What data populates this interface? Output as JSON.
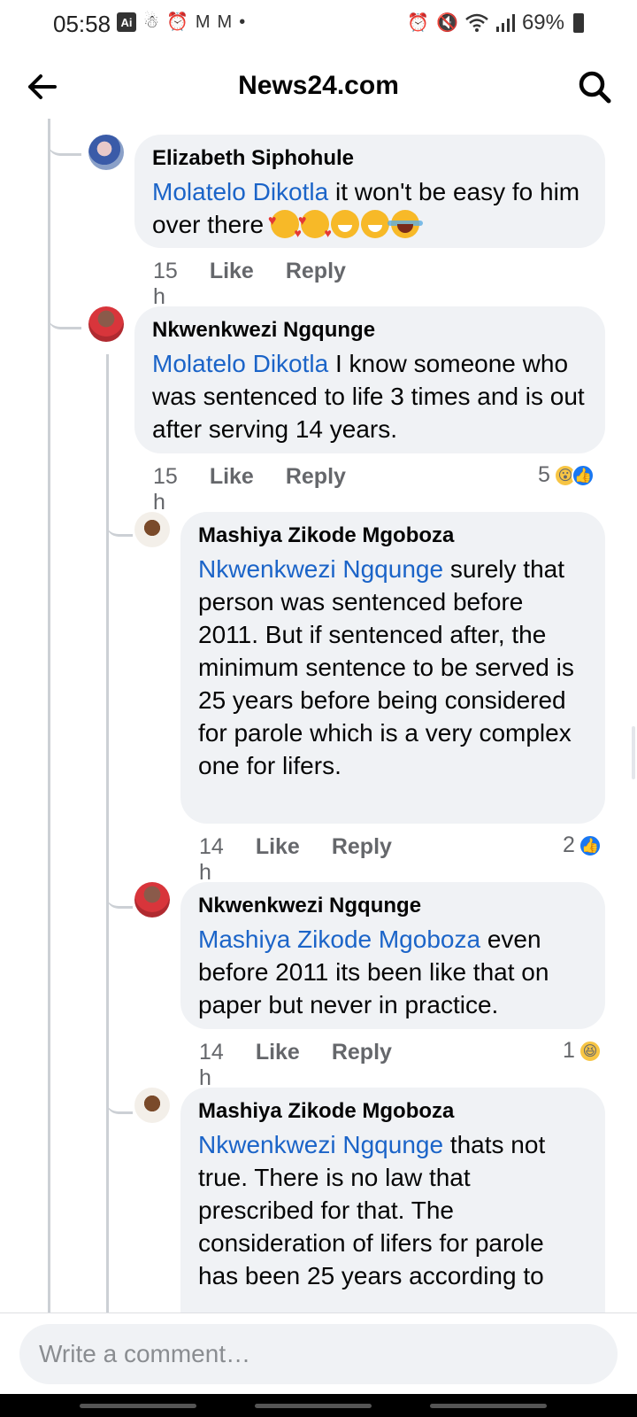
{
  "status_bar": {
    "time": "05:58",
    "ai_badge": "Ai",
    "battery": "69%",
    "left_icons": [
      "figure-icon",
      "alarm-icon",
      "gmail-icon",
      "gmail-icon",
      "dot-icon"
    ],
    "right_icons": [
      "alarm-icon",
      "mute-icon",
      "wifi-icon",
      "signal-icon",
      "battery-icon"
    ]
  },
  "header": {
    "title": "News24.com"
  },
  "comments": [
    {
      "author": "Elizabeth Siphohule",
      "mention": "Molatelo Dikotla",
      "text": " it won't be easy fo him over there ",
      "emojis": [
        "love",
        "love",
        "grin",
        "grin",
        "joy"
      ],
      "time": "15 h",
      "like": "Like",
      "reply": "Reply"
    },
    {
      "author": "Nkwenkwezi Ngqunge",
      "mention": "Molatelo Dikotla",
      "text": " I know someone who was sentenced to life 3 times and is out after serving 14 years.",
      "time": "15 h",
      "like": "Like",
      "reply": "Reply",
      "reaction_count": "5"
    },
    {
      "author": "Mashiya Zikode Mgoboza",
      "mention": "Nkwenkwezi Ngqunge",
      "text": " surely that person was sentenced before 2011. But if sentenced after,  the minimum sentence to be served is 25 years before being considered for parole which is a very complex one for lifers.",
      "time": "14 h",
      "like": "Like",
      "reply": "Reply",
      "reaction_count": "2"
    },
    {
      "author": "Nkwenkwezi Ngqunge",
      "mention": "Mashiya Zikode Mgoboza",
      "text": " even before 2011 its been like that on paper but never in practice.",
      "time": "14 h",
      "like": "Like",
      "reply": "Reply",
      "reaction_count": "1"
    },
    {
      "author": "Mashiya Zikode Mgoboza",
      "mention": "Nkwenkwezi Ngqunge",
      "text": " thats not true. There is no law that prescribed for that. The consideration of lifers for parole has been 25 years according to"
    }
  ],
  "composer": {
    "placeholder": "Write a comment…"
  },
  "colors": {
    "mention": "#1b64c8",
    "bubble": "#f0f2f5",
    "like_reaction": "#1877f2"
  }
}
